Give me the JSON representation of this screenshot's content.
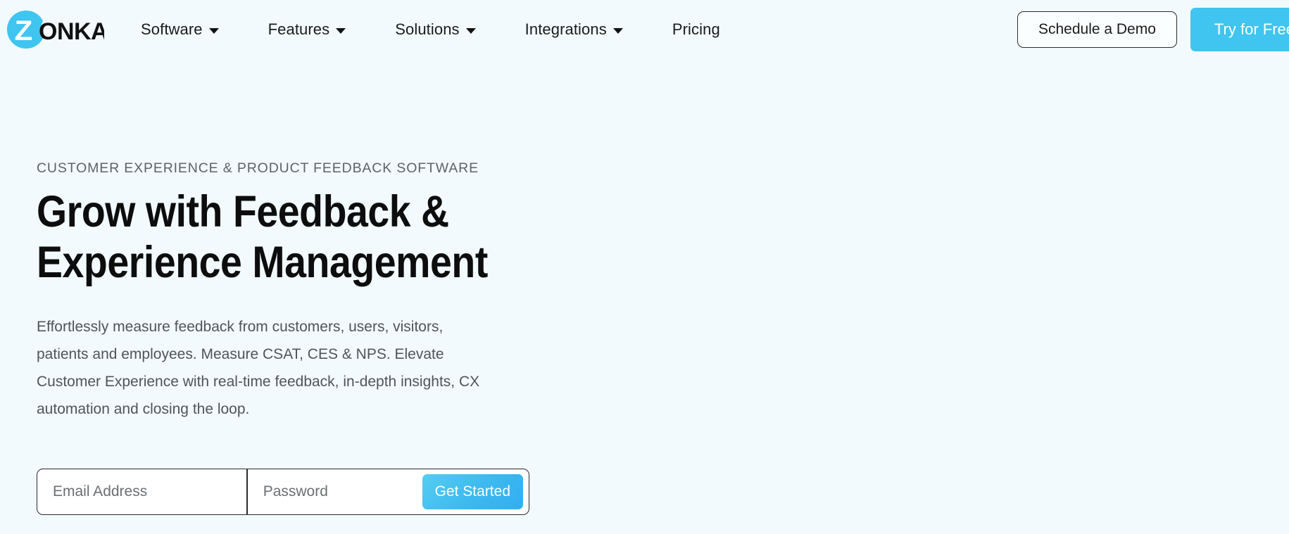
{
  "brand": {
    "logo_mark": "zonka-logo",
    "logo_letter": "Z",
    "logo_word": "ONKA",
    "accent_color": "#3fc5f0",
    "page_background": "#f2fafd"
  },
  "header": {
    "nav": [
      {
        "label": "Software",
        "has_dropdown": true
      },
      {
        "label": "Features",
        "has_dropdown": true
      },
      {
        "label": "Solutions",
        "has_dropdown": true
      },
      {
        "label": "Integrations",
        "has_dropdown": true
      },
      {
        "label": "Pricing",
        "has_dropdown": false
      }
    ],
    "demo_button": "Schedule a Demo",
    "try_button": "Try for Free"
  },
  "hero": {
    "eyebrow": "CUSTOMER EXPERIENCE & PRODUCT FEEDBACK SOFTWARE",
    "headline": "Grow with Feedback &\nExperience Management",
    "subtext": "Effortlessly measure feedback from customers, users, visitors,\npatients and employees. Measure CSAT, CES & NPS. Elevate\nCustomer Experience with real-time feedback, in-depth insights, CX\nautomation and closing the loop."
  },
  "signup": {
    "email_placeholder": "Email Address",
    "email_value": "",
    "password_placeholder": "Password",
    "password_value": "",
    "submit_label": "Get Started"
  }
}
